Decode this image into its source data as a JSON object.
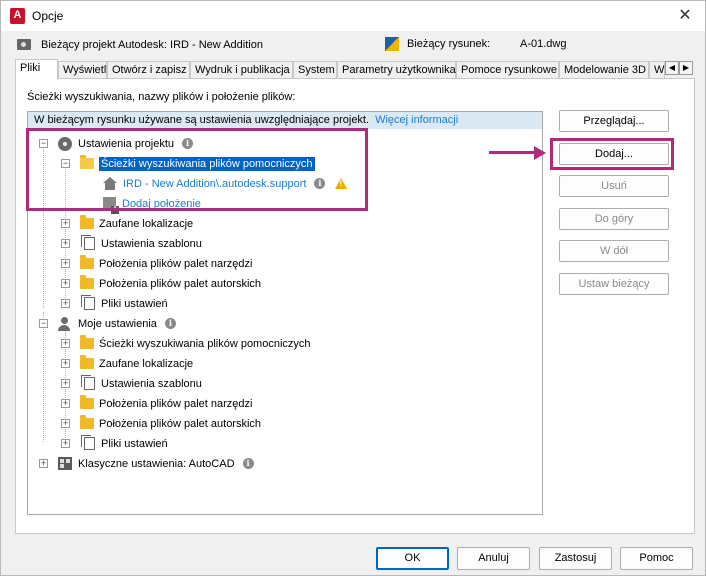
{
  "window": {
    "title": "Opcje",
    "app_icon_letter": "A",
    "close_symbol": "✕"
  },
  "header": {
    "project_label": "Bieżący projekt Autodesk: IRD - New Addition",
    "drawing_label": "Bieżący rysunek:",
    "drawing_value": "A-01.dwg"
  },
  "tabs": [
    "Pliki",
    "Wyświetl",
    "Otwórz i zapisz",
    "Wydruk i publikacja",
    "System",
    "Parametry użytkownika",
    "Pomoce rysunkowe",
    "Modelowanie 3D",
    "W"
  ],
  "tab_scroll": {
    "left": "◀",
    "right": "▶"
  },
  "panel": {
    "label": "Ścieżki wyszukiwania, nazwy plików i położenie plików:",
    "info_text": "W bieżącym rysunku używane są ustawienia uwzględniające projekt.",
    "info_link": "Więcej informacji"
  },
  "tree": {
    "project_settings": "Ustawienia projektu",
    "support_paths": "Ścieżki wyszukiwania plików pomocniczych",
    "support_path_entry": "IRD - New Addition\\.autodesk.support",
    "add_location": "Dodaj położenie",
    "trusted": "Zaufane lokalizacje",
    "template": "Ustawienia szablonu",
    "tool_palettes": "Położenia plików palet narzędzi",
    "authoring_palettes": "Położenia plików palet autorskich",
    "settings_files": "Pliki ustawień",
    "my_settings": "Moje ustawienia",
    "my_support_paths": "Ścieżki wyszukiwania plików pomocniczych",
    "my_trusted": "Zaufane lokalizacje",
    "my_template": "Ustawienia szablonu",
    "my_tool_palettes": "Położenia plików palet narzędzi",
    "my_authoring_palettes": "Położenia plików palet autorskich",
    "my_settings_files": "Pliki ustawień",
    "classic": "Klasyczne ustawienia: AutoCAD",
    "expand_symbol": "+",
    "collapse_symbol": "−"
  },
  "side_buttons": {
    "browse": "Przeglądaj...",
    "add": "Dodaj...",
    "remove": "Usuń",
    "move_up": "Do góry",
    "move_down": "W dół",
    "set_current": "Ustaw bieżący"
  },
  "bottom_buttons": {
    "ok": "OK",
    "cancel": "Anuluj",
    "apply": "Zastosuj",
    "help": "Pomoc"
  },
  "colors": {
    "highlight": "#b0297a",
    "selection": "#0063c8",
    "link": "#1b7bd4",
    "info_bar": "#dbe9f5",
    "folder": "#f2b927",
    "warning": "#f2a900"
  },
  "icons": {
    "info": "i",
    "warning": "warning-icon",
    "project": "project-icon",
    "drawing": "drawing-icon"
  }
}
